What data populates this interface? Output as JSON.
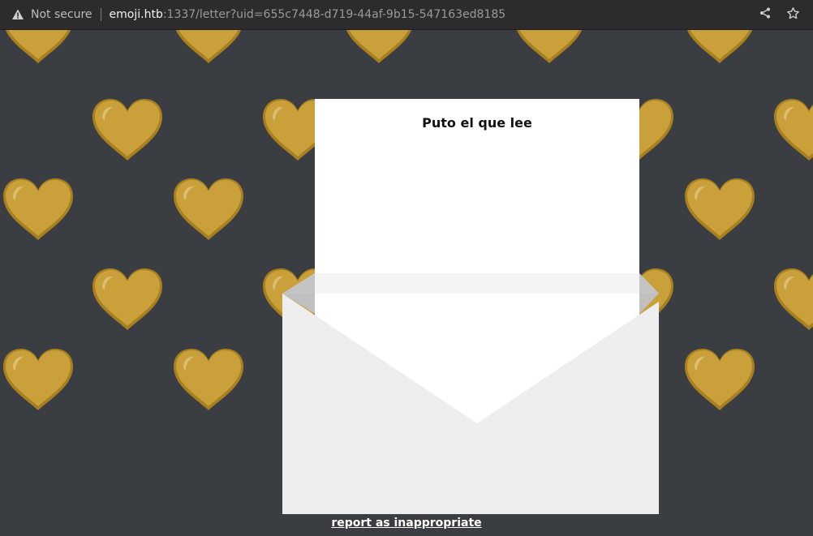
{
  "browser": {
    "security_label": "Not secure",
    "url_host": "emoji.htb",
    "url_path": ":1337/letter?uid=655c7448-d719-44af-9b15-547163ed8185",
    "icons": [
      "warning-icon",
      "share-icon",
      "star-icon"
    ]
  },
  "letter": {
    "message": "Puto el que lee"
  },
  "footer": {
    "report_link": "report as inappropriate"
  },
  "colors": {
    "background": "#3a3d41",
    "heart": "#c9a03a",
    "heart_shadow": "#a8801f",
    "envelope": "#eeeeee",
    "letter": "#ffffff"
  }
}
